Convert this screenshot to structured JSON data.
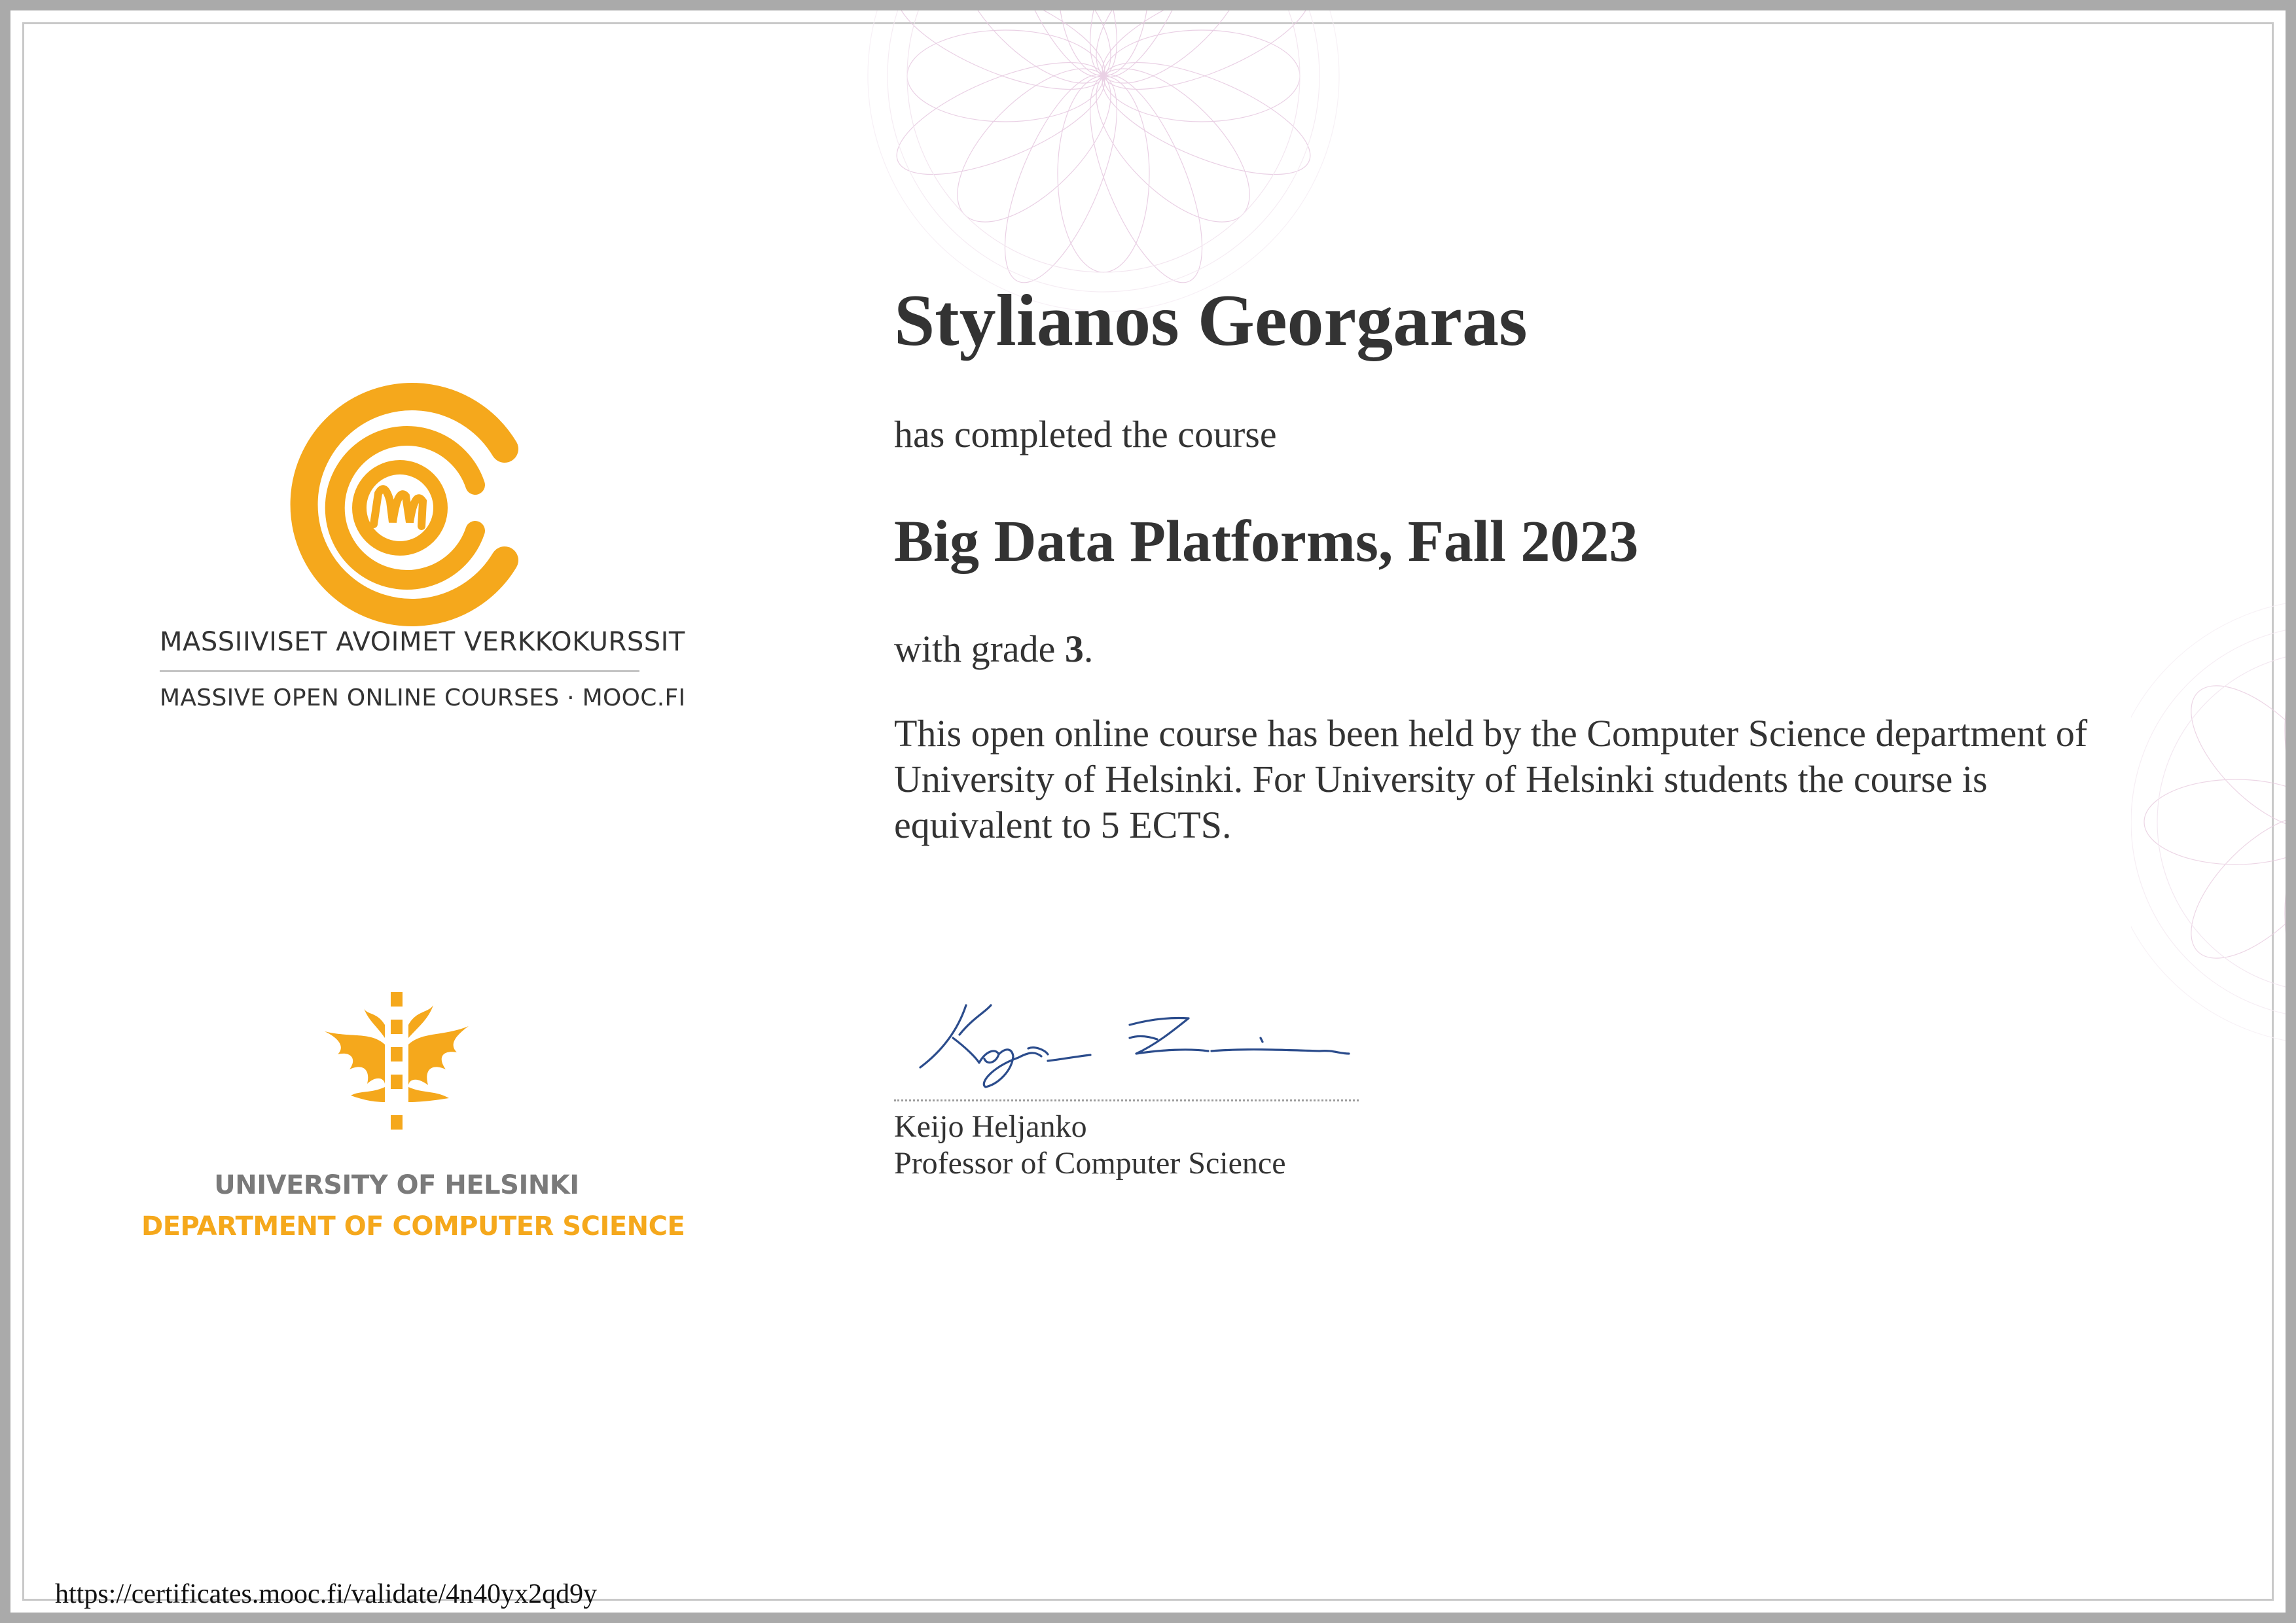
{
  "certificate": {
    "recipient_name": "Stylianos Georgaras",
    "completed_text": "has completed the course",
    "course_name": "Big Data Platforms, Fall 2023",
    "grade_prefix": "with grade",
    "grade_value": "3",
    "grade_suffix": ".",
    "description": "This open online course has been held by the Computer Science department of University of Helsinki. For University of Helsinki students the course is equivalent to 5 ECTS."
  },
  "mooc_logo": {
    "icon": "mooc-logo-icon",
    "line1": "MASSIIVISET AVOIMET VERKKOKURSSIT",
    "line2": "MASSIVE OPEN ONLINE COURSES · MOOC.FI",
    "color": "#f5a81c"
  },
  "university_logo": {
    "icon": "helsinki-flame-icon",
    "name": "UNIVERSITY OF HELSINKI",
    "department": "DEPARTMENT OF COMPUTER SCIENCE",
    "name_color": "#7a7a7a",
    "department_color": "#f5a81c"
  },
  "signatory": {
    "signature_icon": "handwritten-signature",
    "name": "Keijo Heljanko",
    "title": "Professor of Computer Science",
    "ink_color": "#2b4c8c"
  },
  "footer": {
    "validation_url": "https://certificates.mooc.fi/validate/4n40yx2qd9y"
  }
}
